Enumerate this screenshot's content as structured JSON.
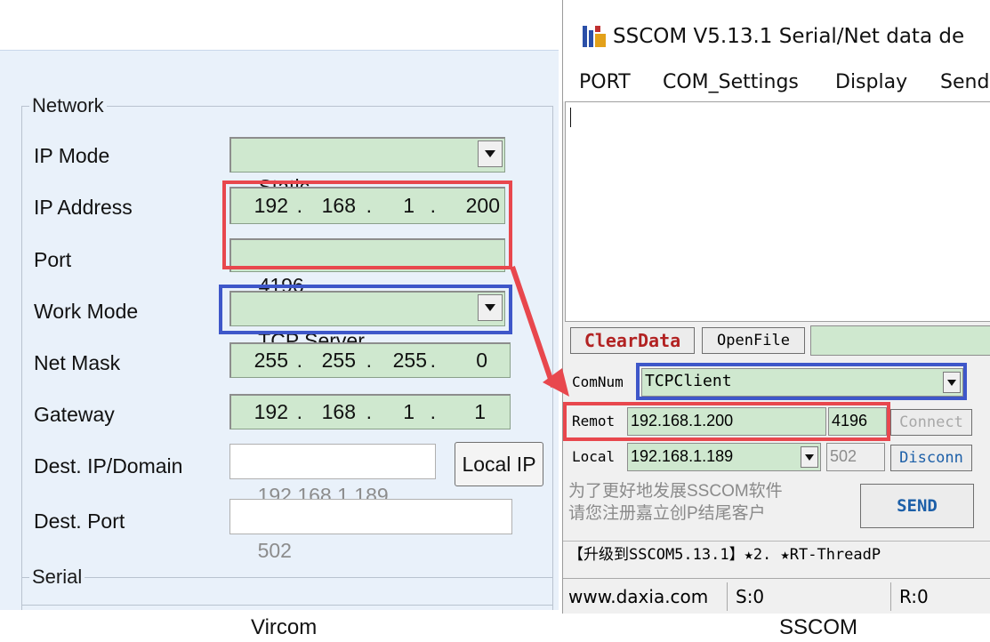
{
  "vircom": {
    "network_title": "Network",
    "ip_mode": {
      "label": "IP Mode",
      "value": "Static"
    },
    "ip_address": {
      "label": "IP Address",
      "octets": [
        "192",
        "168",
        "1",
        "200"
      ]
    },
    "port": {
      "label": "Port",
      "value": "4196"
    },
    "work_mode": {
      "label": "Work Mode",
      "value": "TCP Server"
    },
    "net_mask": {
      "label": "Net Mask",
      "octets": [
        "255",
        "255",
        "255",
        "0"
      ]
    },
    "gateway": {
      "label": "Gateway",
      "octets": [
        "192",
        "168",
        "1",
        "1"
      ]
    },
    "dest_ip": {
      "label": "Dest. IP/Domain",
      "value": "192.168.1.189"
    },
    "local_ip_button": "Local IP",
    "dest_port": {
      "label": "Dest. Port",
      "value": "502"
    },
    "serial_title": "Serial"
  },
  "sscom": {
    "title": "SSCOM V5.13.1 Serial/Net data de",
    "menu": [
      "PORT",
      "COM_Settings",
      "Display",
      "Send"
    ],
    "clear_data": "ClearData",
    "open_file": "OpenFile",
    "comnum_label": "ComNum",
    "comnum_value": "TCPClient",
    "remote_label": "Remot",
    "remote_ip": "192.168.1.200",
    "remote_port": "4196",
    "connect_button": "Connect",
    "local_label": "Local",
    "local_ip": "192.168.1.189",
    "local_port": "502",
    "disconnect_button": "Disconn",
    "promo_line1": "为了更好地发展SSCOM软件",
    "promo_line2": "请您注册嘉立创P结尾客户",
    "send_button": "SEND",
    "upgrade_banner": "【升级到SSCOM5.13.1】★2. ★RT-ThreadP",
    "status_site": "www.daxia.com",
    "status_s": "S:0",
    "status_r": "R:0"
  },
  "captions": {
    "left": "Vircom",
    "right": "SSCOM"
  },
  "colors": {
    "field_green": "#cfe8cf",
    "highlight_red": "#e8474d",
    "highlight_blue": "#3e57c9",
    "panel_bg": "#e9f1fa"
  }
}
